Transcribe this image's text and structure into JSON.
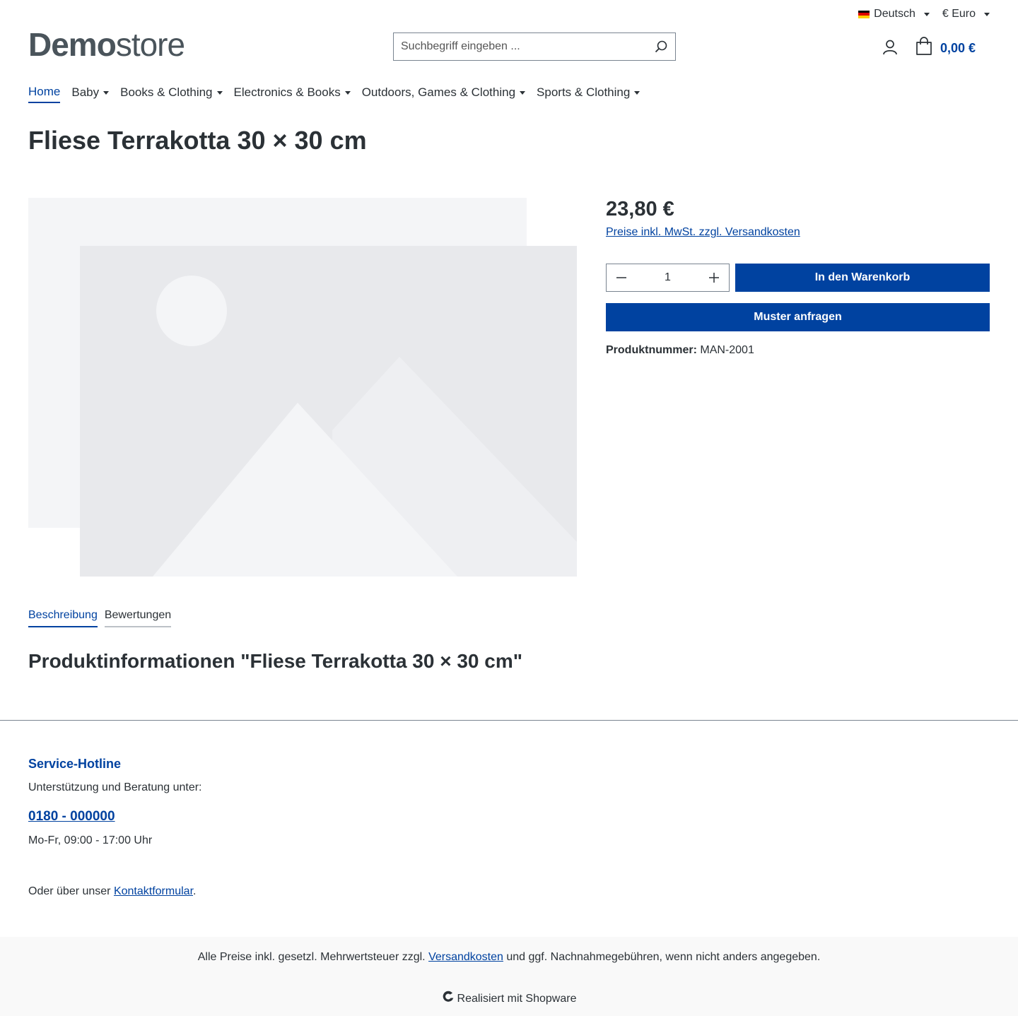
{
  "topbar": {
    "language": "Deutsch",
    "currency": "€ Euro"
  },
  "logo": {
    "bold": "Demo",
    "light": "store"
  },
  "search": {
    "placeholder": "Suchbegriff eingeben ..."
  },
  "cart": {
    "total": "0,00 €"
  },
  "nav": {
    "items": [
      {
        "label": "Home"
      },
      {
        "label": "Baby"
      },
      {
        "label": "Books & Clothing"
      },
      {
        "label": "Electronics & Books"
      },
      {
        "label": "Outdoors, Games & Clothing"
      },
      {
        "label": "Sports & Clothing"
      }
    ]
  },
  "product": {
    "title": "Fliese Terrakotta 30 × 30 cm",
    "price": "23,80 €",
    "tax_link": "Preise inkl. MwSt. zzgl. Versandkosten",
    "quantity": "1",
    "add_to_cart": "In den Warenkorb",
    "request_sample": "Muster anfragen",
    "number_label": "Produktnummer:",
    "number_value": "MAN-2001"
  },
  "tabs": [
    {
      "label": "Beschreibung"
    },
    {
      "label": "Bewertungen"
    }
  ],
  "info": {
    "title": "Produktinformationen \"Fliese Terrakotta 30 × 30 cm\""
  },
  "footer": {
    "hotline_title": "Service-Hotline",
    "hotline_sub": "Unterstützung und Beratung unter:",
    "phone": "0180 - 000000",
    "hours": "Mo-Fr, 09:00 - 17:00 Uhr",
    "contact_prefix": "Oder über unser ",
    "contact_link": "Kontaktformular",
    "contact_suffix": ".",
    "vat_prefix": "Alle Preise inkl. gesetzl. Mehrwertsteuer zzgl. ",
    "vat_link": "Versandkosten",
    "vat_suffix": " und ggf. Nachnahmegebühren, wenn nicht anders angegeben.",
    "powered": "Realisiert mit Shopware"
  },
  "colors": {
    "primary": "#0042a0",
    "text": "#2b3136",
    "placeholder_dark": "#e8e9ec",
    "placeholder_light": "#f4f5f7"
  }
}
